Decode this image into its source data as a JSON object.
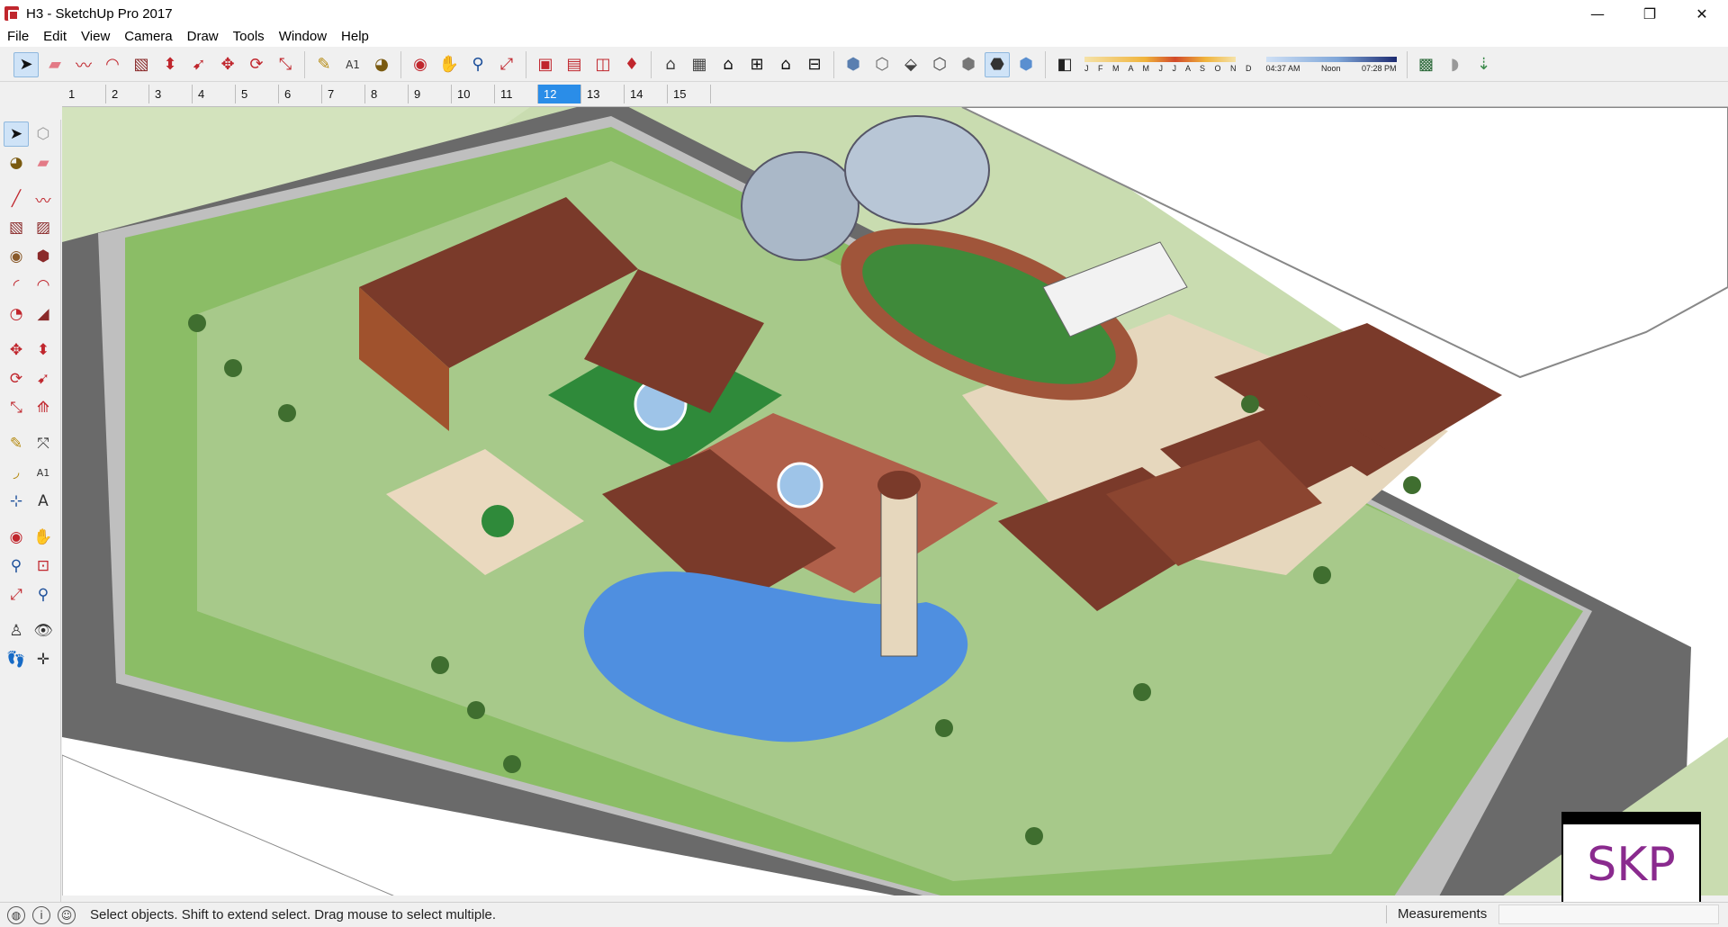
{
  "window": {
    "title": "H3 - SketchUp Pro 2017",
    "controls": {
      "minimize": "—",
      "maximize": "❐",
      "close": "✕"
    }
  },
  "menu": {
    "items": [
      "File",
      "Edit",
      "View",
      "Camera",
      "Draw",
      "Tools",
      "Window",
      "Help"
    ]
  },
  "toolbar": {
    "icons": [
      "select-icon",
      "eraser-icon",
      "freehand-icon",
      "arc-icon",
      "rectangle-icon",
      "push-pull-icon",
      "follow-me-icon",
      "move-icon",
      "rotate-icon",
      "scale-icon",
      "tape-measure-icon",
      "text-icon",
      "paint-bucket-icon",
      "orbit-icon",
      "pan-icon",
      "zoom-icon",
      "zoom-extents-icon",
      "warehouse-icon",
      "extension-warehouse-icon",
      "layout-icon",
      "ruby-icon",
      "iso-view-icon",
      "top-view-icon",
      "front-view-icon",
      "right-view-icon",
      "back-view-icon",
      "left-view-icon",
      "xray-icon",
      "back-edges-icon",
      "wireframe-icon",
      "hidden-line-icon",
      "shaded-icon",
      "shaded-textures-icon",
      "monochrome-icon",
      "shadows-icon"
    ],
    "shadow_months": "J F M A M J J A S O N D",
    "shadow_time_start": "04:37 AM",
    "shadow_time_mid": "Noon",
    "shadow_time_end": "07:28 PM"
  },
  "scenes": {
    "tabs": [
      "1",
      "2",
      "3",
      "4",
      "5",
      "6",
      "7",
      "8",
      "9",
      "10",
      "11",
      "12",
      "13",
      "14",
      "15"
    ],
    "active": "12"
  },
  "left_toolbar": {
    "icons": [
      "select-icon",
      "component-icon",
      "paint-bucket-icon",
      "eraser-icon",
      "line-icon",
      "freehand-icon",
      "rectangle-icon",
      "rotated-rectangle-icon",
      "circle-icon",
      "polygon-icon",
      "arc-icon",
      "two-point-arc-icon",
      "pie-icon",
      "three-point-arc-icon",
      "move-icon",
      "push-pull-icon",
      "rotate-icon",
      "follow-me-icon",
      "scale-icon",
      "offset-icon",
      "tape-measure-icon",
      "dimension-icon",
      "protractor-icon",
      "text-icon",
      "axes-icon",
      "3d-text-icon",
      "orbit-icon",
      "pan-icon",
      "zoom-icon",
      "zoom-window-icon",
      "zoom-extents-icon",
      "previous-view-icon",
      "position-camera-icon",
      "look-around-icon",
      "walk-icon",
      "section-plane-icon"
    ]
  },
  "status": {
    "hint": "Select objects. Shift to extend select. Drag mouse to select multiple.",
    "measurements_label": "Measurements",
    "measurements_value": ""
  },
  "watermark": {
    "text": "SKP"
  },
  "colors": {
    "accent": "#2a8de8",
    "grass": "#8bbd66",
    "lawn": "#c9dcb0",
    "road": "#666666",
    "roof": "#7a3a2a",
    "water": "#4f8fe0"
  }
}
